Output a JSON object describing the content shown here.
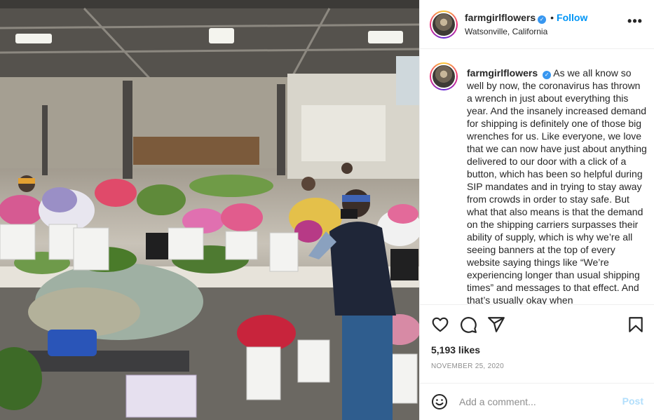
{
  "post": {
    "username": "farmgirlflowers",
    "separator": "•",
    "follow_label": "Follow",
    "location": "Watsonville, California",
    "more_label": "•••",
    "caption": "As we all know so well by now, the coronavirus has thrown a wrench in just about everything this year. And the insanely increased demand for shipping is definitely one of those big wrenches for us. Like everyone, we love that we can now have just about anything delivered to our door with a click of a button, which has been so helpful during SIP mandates and in trying to stay away from crowds in order to stay safe. But what that also means is that the demand on the shipping carriers surpasses their ability of supply, which is why we’re all seeing banners at the top of every website saying things like “We’re experiencing longer than usual shipping times” and messages to that effect. And that’s usually okay when",
    "likes": "5,193 likes",
    "date": "NOVEMBER 25, 2020"
  },
  "comment": {
    "placeholder": "Add a comment...",
    "post_label": "Post"
  },
  "icons": {
    "verified": "verified-badge-icon",
    "like": "heart-icon",
    "comment": "comment-bubble-icon",
    "share": "paper-plane-icon",
    "save": "bookmark-icon",
    "emoji": "emoji-smiley-icon"
  },
  "colors": {
    "accent": "#0095f6",
    "verified": "#3897f0",
    "muted": "#8e8e8e",
    "post_disabled": "#b2dffc"
  }
}
